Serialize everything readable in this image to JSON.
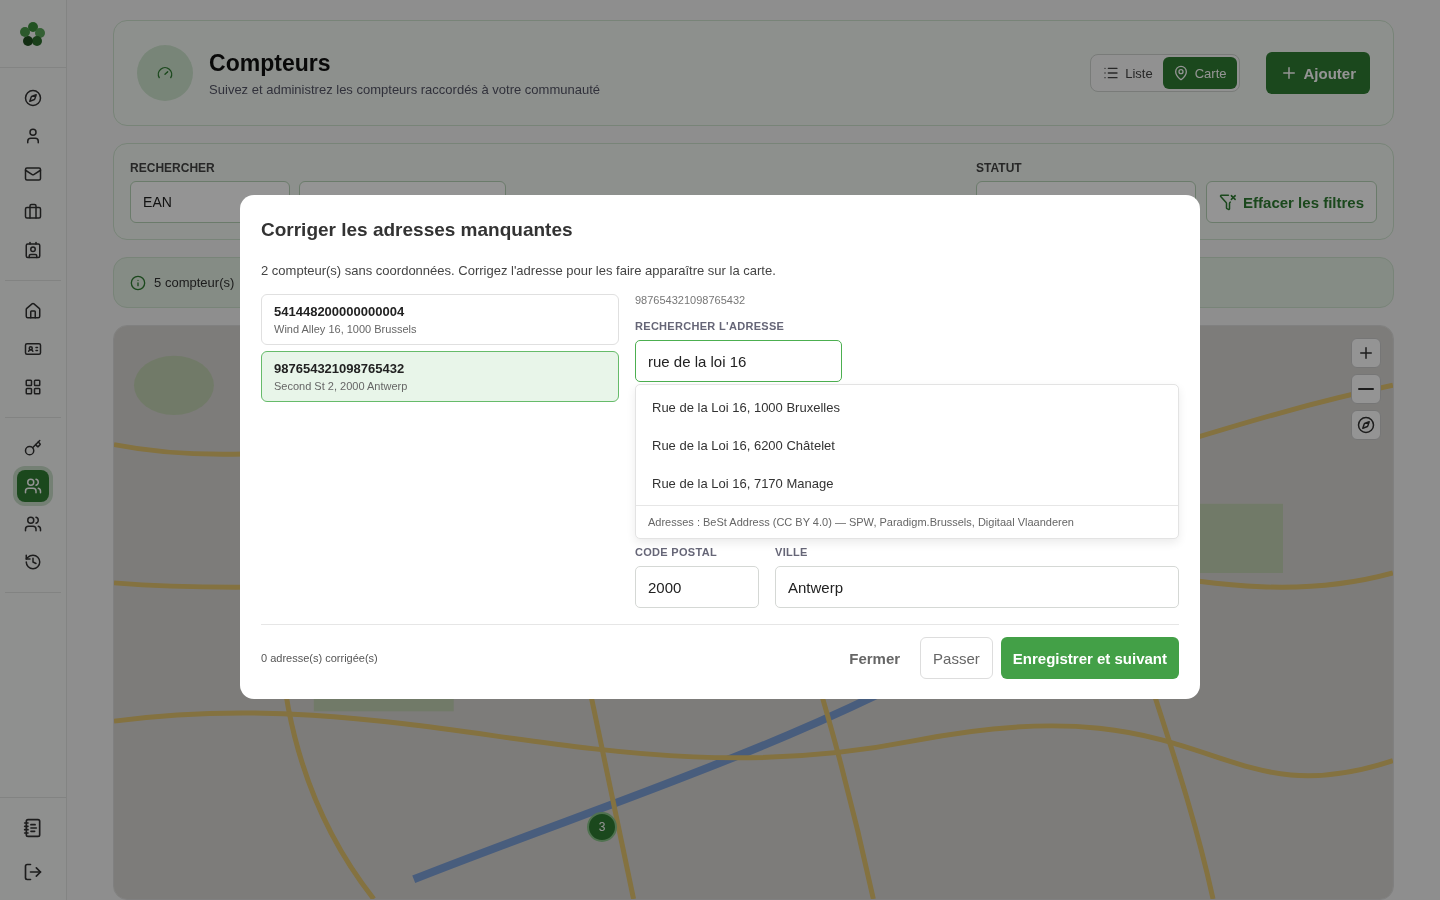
{
  "sidebar": {
    "groups": [
      {
        "items": [
          {
            "selected": false
          },
          {
            "selected": false
          },
          {
            "selected": false
          },
          {
            "selected": false
          },
          {
            "selected": false
          }
        ]
      },
      {
        "items": [
          {
            "selected": false
          },
          {
            "selected": false
          },
          {
            "selected": false
          }
        ]
      },
      {
        "items": [
          {
            "selected": false
          },
          {
            "selected": true
          },
          {
            "selected": false
          },
          {
            "selected": false
          }
        ]
      }
    ]
  },
  "header": {
    "title": "Compteurs",
    "subtitle": "Suivez et administrez les compteurs raccordés à votre communauté",
    "view_toggle": [
      {
        "label": "Liste",
        "selected": false
      },
      {
        "label": "Carte",
        "selected": true
      }
    ],
    "add_button": "Ajouter"
  },
  "filters": {
    "search_label": "RECHERCHER",
    "search_type": "EAN",
    "status_label": "STATUT",
    "clear_button": "Effacer les filtres"
  },
  "info_bar": {
    "text": "5 compteur(s)"
  },
  "map": {
    "cluster_count": "3"
  },
  "dialog": {
    "title": "Corriger les adresses manquantes",
    "description": "2 compteur(s) sans coordonnées. Corrigez l'adresse pour les faire apparaître sur la carte.",
    "meters": [
      {
        "ean": "541448200000000004",
        "address": "Wind Alley 16, 1000 Brussels",
        "selected": false
      },
      {
        "ean": "987654321098765432",
        "address": "Second St 2, 2000 Antwerp",
        "selected": true
      }
    ],
    "current_ean": "987654321098765432",
    "search_label": "RECHERCHER L'ADRESSE",
    "search_value": "rue de la loi 16",
    "suggestions": [
      "Rue de la Loi 16, 1000 Bruxelles",
      "Rue de la Loi 16, 6200 Châtelet",
      "Rue de la Loi 16, 7170 Manage"
    ],
    "attribution": "Adresses : BeSt Address (CC BY 4.0) — SPW, Paradigm.Brussels, Digitaal Vlaanderen",
    "postal_label": "CODE POSTAL",
    "postal_value": "2000",
    "city_label": "VILLE",
    "city_value": "Antwerp",
    "corrected_count": "0 adresse(s) corrigée(s)",
    "close_button": "Fermer",
    "skip_button": "Passer",
    "save_button": "Enregistrer et suivant"
  }
}
